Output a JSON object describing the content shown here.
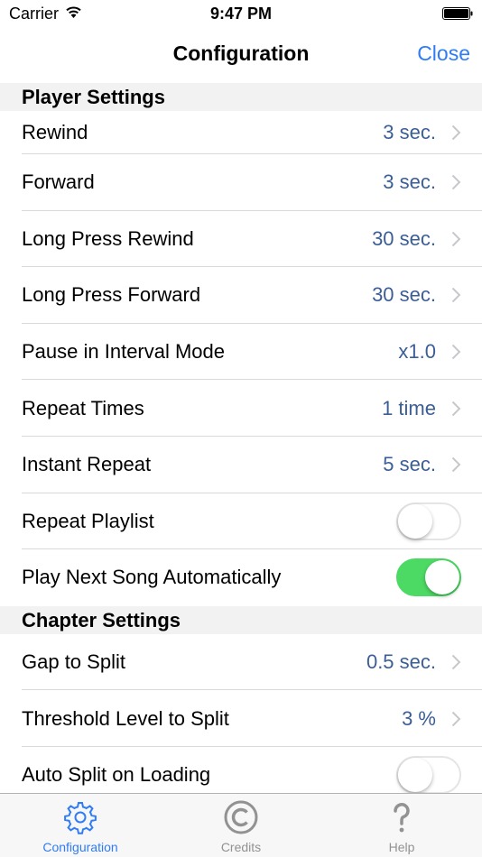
{
  "status": {
    "carrier": "Carrier",
    "time": "9:47 PM"
  },
  "nav": {
    "title": "Configuration",
    "close_label": "Close"
  },
  "sections": [
    {
      "header": "Player Settings",
      "rows": [
        {
          "label": "Rewind",
          "value": "3 sec."
        },
        {
          "label": "Forward",
          "value": "3 sec."
        },
        {
          "label": "Long Press Rewind",
          "value": "30 sec."
        },
        {
          "label": "Long Press Forward",
          "value": "30 sec."
        },
        {
          "label": "Pause in Interval Mode",
          "value": "x1.0"
        },
        {
          "label": "Repeat Times",
          "value": "1 time"
        },
        {
          "label": "Instant Repeat",
          "value": "5 sec."
        },
        {
          "label": "Repeat Playlist",
          "toggle": false
        },
        {
          "label": "Play Next Song Automatically",
          "toggle": true
        }
      ]
    },
    {
      "header": "Chapter Settings",
      "rows": [
        {
          "label": "Gap to Split",
          "value": "0.5 sec."
        },
        {
          "label": "Threshold Level to Split",
          "value": "3 %"
        },
        {
          "label": "Auto Split on Loading",
          "toggle": false
        }
      ]
    }
  ],
  "tabs": [
    {
      "label": "Configuration",
      "icon": "gear-icon",
      "active": true
    },
    {
      "label": "Credits",
      "icon": "copyright-icon",
      "active": false
    },
    {
      "label": "Help",
      "icon": "question-icon",
      "active": false
    }
  ],
  "colors": {
    "accent": "#2f7cf6",
    "value_text": "#3b5e97",
    "toggle_on": "#4cd964"
  }
}
